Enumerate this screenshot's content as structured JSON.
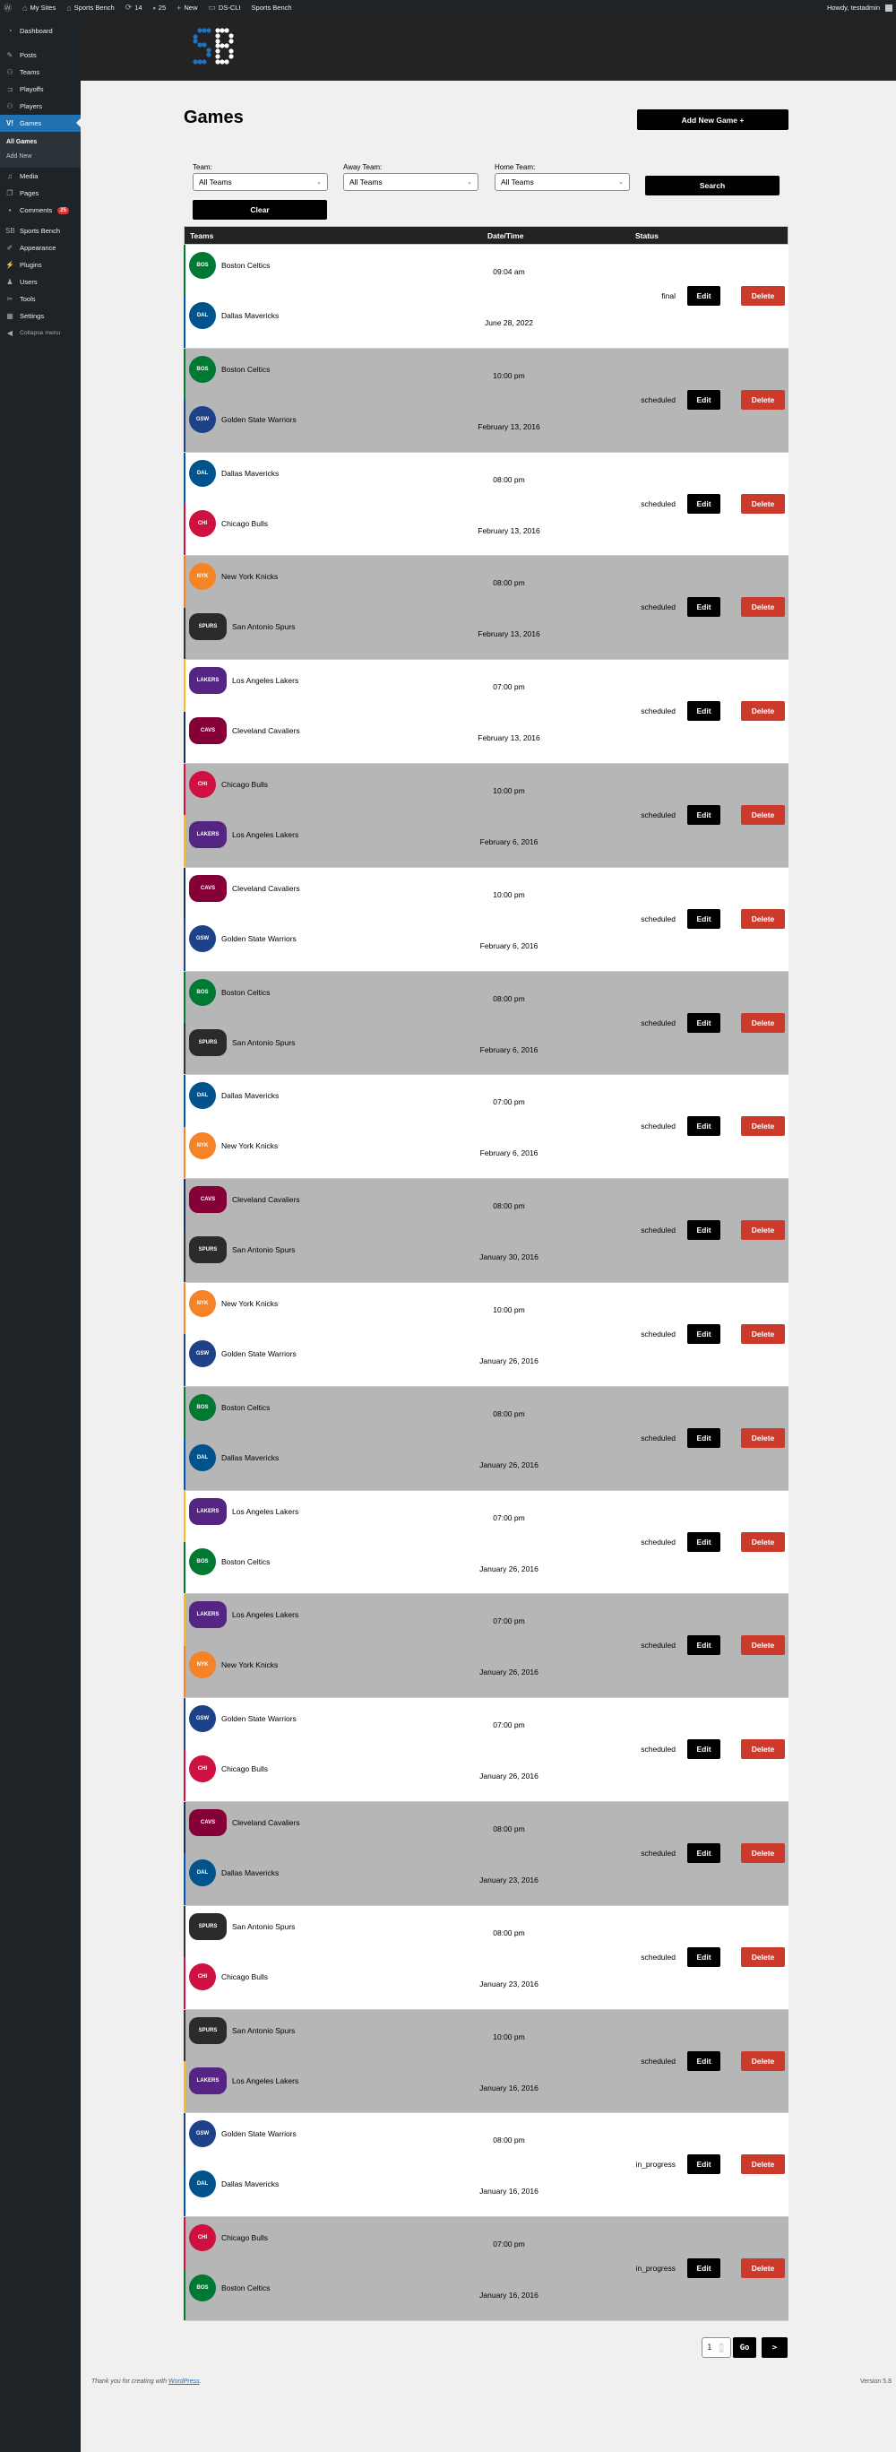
{
  "adminbar": {
    "items": [
      {
        "icon": "wordpress-icon",
        "label": ""
      },
      {
        "icon": "my-sites-icon",
        "label": "My Sites"
      },
      {
        "icon": "home-icon",
        "label": "Sports Bench"
      },
      {
        "icon": "updates-icon",
        "label": "14"
      },
      {
        "icon": "comments-icon",
        "label": "25"
      },
      {
        "icon": "plus-icon",
        "label": "New"
      },
      {
        "icon": "cli-icon",
        "label": "DS-CLI"
      },
      {
        "icon": "",
        "label": "Sports Bench"
      }
    ],
    "greeting": "Howdy, testadmin"
  },
  "sidebar": {
    "items": [
      {
        "icon": "dashboard-icon",
        "label": "Dashboard"
      },
      {
        "icon": "pin-icon",
        "label": "Posts"
      },
      {
        "icon": "teams-icon",
        "label": "Teams"
      },
      {
        "icon": "bracket-icon",
        "label": "Playoffs"
      },
      {
        "icon": "players-icon",
        "label": "Players"
      },
      {
        "icon": "games-icon",
        "label": "Games"
      },
      {
        "icon": "media-icon",
        "label": "Media"
      },
      {
        "icon": "pages-icon",
        "label": "Pages"
      },
      {
        "icon": "comment-icon",
        "label": "Comments",
        "badge": "25"
      },
      {
        "icon": "sb-icon",
        "label": "Sports Bench"
      },
      {
        "icon": "brush-icon",
        "label": "Appearance"
      },
      {
        "icon": "plug-icon",
        "label": "Plugins"
      },
      {
        "icon": "user-icon",
        "label": "Users"
      },
      {
        "icon": "wrench-icon",
        "label": "Tools"
      },
      {
        "icon": "settings-icon",
        "label": "Settings"
      },
      {
        "icon": "collapse-icon",
        "label": "Collapse menu"
      }
    ],
    "submenu": [
      "All Games",
      "Add New"
    ]
  },
  "logo": {
    "text": "SB",
    "accent": "#1e73be"
  },
  "page": {
    "title": "Games",
    "add_new_label": "Add New Game +",
    "filters": {
      "team_label": "Team:",
      "team_value": "All Teams",
      "away_label": "Away Team:",
      "away_value": "All Teams",
      "home_label": "Home Team:",
      "home_value": "All Teams",
      "search_label": "Search",
      "clear_label": "Clear"
    }
  },
  "table": {
    "headers": {
      "teams": "Teams",
      "datetime": "Date/Time",
      "status": "Status"
    },
    "edit_label": "Edit",
    "delete_label": "Delete",
    "games": [
      {
        "away": "Boston Celtics",
        "home": "Dallas Mavericks",
        "time": "09:04 am",
        "date": "June 28, 2022",
        "status": "final"
      },
      {
        "away": "Boston Celtics",
        "home": "Golden State Warriors",
        "time": "10:00 pm",
        "date": "February 13, 2016",
        "status": "scheduled"
      },
      {
        "away": "Dallas Mavericks",
        "home": "Chicago Bulls",
        "time": "08:00 pm",
        "date": "February 13, 2016",
        "status": "scheduled"
      },
      {
        "away": "New York Knicks",
        "home": "San Antonio Spurs",
        "time": "08:00 pm",
        "date": "February 13, 2016",
        "status": "scheduled"
      },
      {
        "away": "Los Angeles Lakers",
        "home": "Cleveland Cavaliers",
        "time": "07:00 pm",
        "date": "February 13, 2016",
        "status": "scheduled"
      },
      {
        "away": "Chicago Bulls",
        "home": "Los Angeles Lakers",
        "time": "10:00 pm",
        "date": "February 6, 2016",
        "status": "scheduled"
      },
      {
        "away": "Cleveland Cavaliers",
        "home": "Golden State Warriors",
        "time": "10:00 pm",
        "date": "February 6, 2016",
        "status": "scheduled"
      },
      {
        "away": "Boston Celtics",
        "home": "San Antonio Spurs",
        "time": "08:00 pm",
        "date": "February 6, 2016",
        "status": "scheduled"
      },
      {
        "away": "Dallas Mavericks",
        "home": "New York Knicks",
        "time": "07:00 pm",
        "date": "February 6, 2016",
        "status": "scheduled"
      },
      {
        "away": "Cleveland Cavaliers",
        "home": "San Antonio Spurs",
        "time": "08:00 pm",
        "date": "January 30, 2016",
        "status": "scheduled"
      },
      {
        "away": "New York Knicks",
        "home": "Golden State Warriors",
        "time": "10:00 pm",
        "date": "January 26, 2016",
        "status": "scheduled"
      },
      {
        "away": "Boston Celtics",
        "home": "Dallas Mavericks",
        "time": "08:00 pm",
        "date": "January 26, 2016",
        "status": "scheduled"
      },
      {
        "away": "Los Angeles Lakers",
        "home": "Boston Celtics",
        "time": "07:00 pm",
        "date": "January 26, 2016",
        "status": "scheduled"
      },
      {
        "away": "Los Angeles Lakers",
        "home": "New York Knicks",
        "time": "07:00 pm",
        "date": "January 26, 2016",
        "status": "scheduled"
      },
      {
        "away": "Golden State Warriors",
        "home": "Chicago Bulls",
        "time": "07:00 pm",
        "date": "January 26, 2016",
        "status": "scheduled"
      },
      {
        "away": "Cleveland Cavaliers",
        "home": "Dallas Mavericks",
        "time": "08:00 pm",
        "date": "January 23, 2016",
        "status": "scheduled"
      },
      {
        "away": "San Antonio Spurs",
        "home": "Chicago Bulls",
        "time": "08:00 pm",
        "date": "January 23, 2016",
        "status": "scheduled"
      },
      {
        "away": "San Antonio Spurs",
        "home": "Los Angeles Lakers",
        "time": "10:00 pm",
        "date": "January 16, 2016",
        "status": "scheduled"
      },
      {
        "away": "Golden State Warriors",
        "home": "Dallas Mavericks",
        "time": "08:00 pm",
        "date": "January 16, 2016",
        "status": "in_progress"
      },
      {
        "away": "Chicago Bulls",
        "home": "Boston Celtics",
        "time": "07:00 pm",
        "date": "January 16, 2016",
        "status": "in_progress"
      }
    ]
  },
  "team_styles": {
    "Boston Celtics": {
      "color": "#007a33",
      "logo_bg": "#007a33",
      "abbr": "BOS",
      "icon": "celtics-logo-icon"
    },
    "Dallas Mavericks": {
      "color": "#0053bc",
      "logo_bg": "#00538c",
      "abbr": "DAL",
      "icon": "mavericks-logo-icon"
    },
    "Golden State Warriors": {
      "color": "#1d428a",
      "logo_bg": "#1d428a",
      "abbr": "GSW",
      "icon": "warriors-logo-icon"
    },
    "Chicago Bulls": {
      "color": "#ce1141",
      "logo_bg": "#ce1141",
      "abbr": "CHI",
      "icon": "bulls-logo-icon"
    },
    "New York Knicks": {
      "color": "#f58426",
      "logo_bg": "#f58426",
      "abbr": "NYK",
      "icon": "knicks-logo-icon"
    },
    "San Antonio Spurs": {
      "color": "#333333",
      "logo_bg": "#2b2b2b",
      "abbr": "SPURS",
      "icon": "spurs-logo-icon"
    },
    "Los Angeles Lakers": {
      "color": "#fdb927",
      "logo_bg": "#552583",
      "abbr": "LAKERS",
      "icon": "lakers-logo-icon"
    },
    "Cleveland Cavaliers": {
      "color": "#1d2d5c",
      "logo_bg": "#860038",
      "abbr": "CAVS",
      "icon": "cavaliers-logo-icon"
    }
  },
  "pagination": {
    "page": "1",
    "go_label": "Go",
    "next_label": ">"
  },
  "footer": {
    "text": "Thank you for creating with ",
    "link": "WordPress",
    "suffix": ".",
    "version": "Version 5.8"
  }
}
